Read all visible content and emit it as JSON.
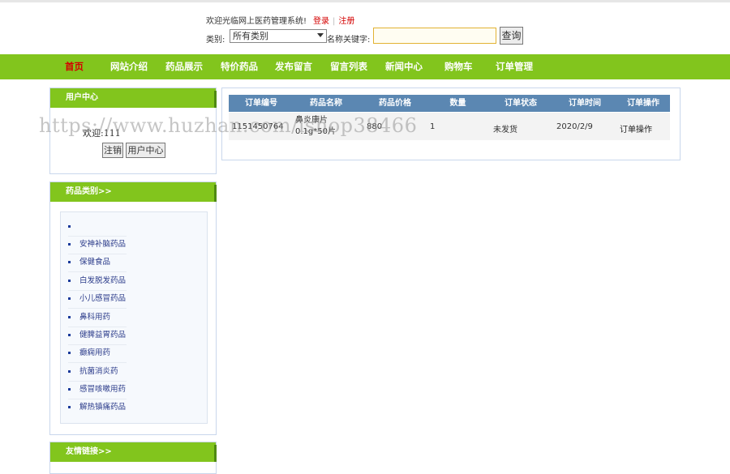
{
  "header": {
    "welcome_text": "欢迎光临网上医药管理系统!",
    "login_link": "登录",
    "register_link": "注册",
    "category_label": "类别:",
    "category_selected": "所有类别",
    "keyword_label": "名称关键字:",
    "keyword_value": "",
    "search_button": "查询"
  },
  "nav": {
    "items": [
      "首页",
      "网站介绍",
      "药品展示",
      "特价药品",
      "发布留言",
      "留言列表",
      "新闻中心",
      "购物车",
      "订单管理"
    ],
    "active_color": "#d40000",
    "bar_color": "#82c51d"
  },
  "sidebar": {
    "user_center": {
      "title": "用户中心",
      "welcome": "欢迎:111",
      "logout_button": "注销",
      "user_center_button": "用户中心"
    },
    "categories": {
      "title": "药品类别>>",
      "items": [
        "",
        "安神补脑药品",
        "保健食品",
        "白发脱发药品",
        "小儿感冒药品",
        "鼻科用药",
        "健脾益胃药品",
        "癫痫用药",
        "抗菌消炎药",
        "感冒咳嗽用药",
        "解热镇痛药品"
      ]
    },
    "links": {
      "title": "友情链接>>"
    }
  },
  "orders": {
    "headers": [
      "订单编号",
      "药品名称",
      "药品价格",
      "数量",
      "订单状态",
      "订单时间",
      "订单操作"
    ],
    "rows": [
      {
        "id": "1151450764",
        "name_line1": "鼻炎康片",
        "name_line2": "0.1g*50片",
        "price": "880",
        "qty": "1",
        "status": "未发货",
        "time": "2020/2/9",
        "action": "订单操作"
      }
    ],
    "header_color": "#5b87b2"
  },
  "watermark": "https://www.huzhan.com/ishop38466"
}
